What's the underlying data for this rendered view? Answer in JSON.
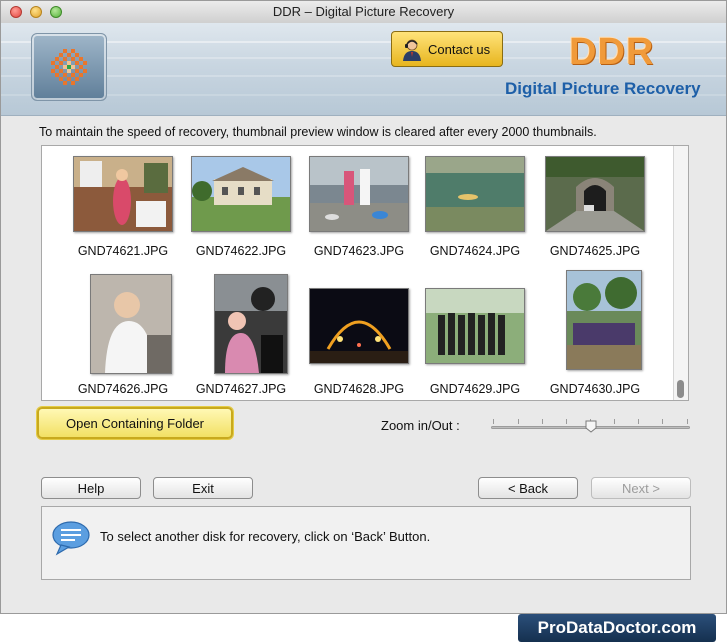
{
  "window": {
    "title": "DDR – Digital Picture Recovery"
  },
  "header": {
    "contact_label": "Contact us",
    "brand_title": "DDR",
    "brand_subtitle": "Digital Picture Recovery",
    "logo_icon": "ddr-logo-icon",
    "contact_icon": "support-agent-icon"
  },
  "notice": "To maintain the speed of recovery, thumbnail preview window is cleared after every 2000 thumbnails.",
  "thumbnails": [
    {
      "name": "GND74621.JPG"
    },
    {
      "name": "GND74622.JPG"
    },
    {
      "name": "GND74623.JPG"
    },
    {
      "name": "GND74624.JPG"
    },
    {
      "name": "GND74625.JPG"
    },
    {
      "name": "GND74626.JPG"
    },
    {
      "name": "GND74627.JPG"
    },
    {
      "name": "GND74628.JPG"
    },
    {
      "name": "GND74629.JPG"
    },
    {
      "name": "GND74630.JPG"
    }
  ],
  "actions": {
    "open_folder": "Open Containing Folder",
    "zoom_label": "Zoom in/Out :",
    "zoom_level": 0.5
  },
  "nav": {
    "help": "Help",
    "exit": "Exit",
    "back": "< Back",
    "next": "Next >"
  },
  "status": {
    "message": "To select another disk for recovery, click on ‘Back’ Button.",
    "icon": "chat-bubble-icon"
  },
  "footer": {
    "site": "ProDataDoctor.com"
  },
  "colors": {
    "brand_orange": "#f09a3a",
    "brand_blue": "#1d5fa8",
    "contact_yellow": "#e7b51e"
  }
}
